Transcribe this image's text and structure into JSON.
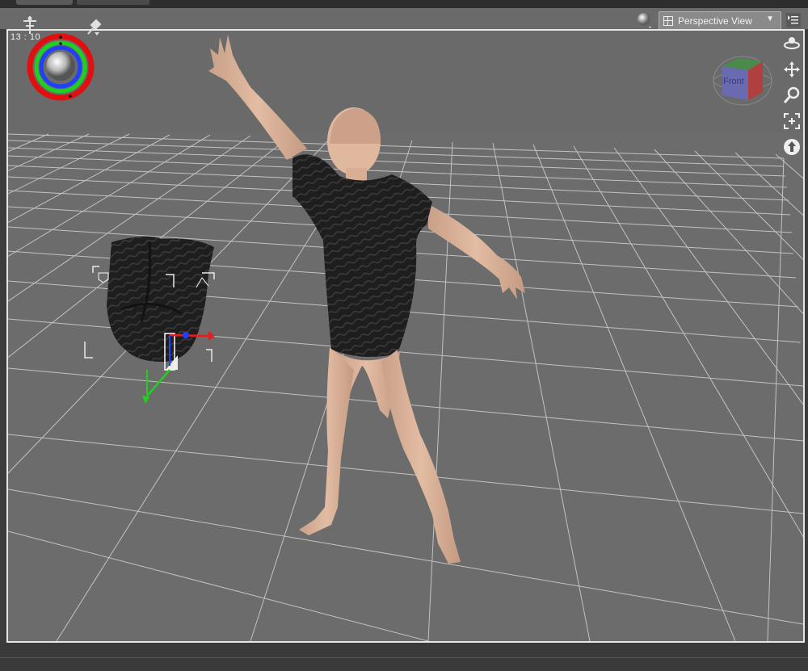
{
  "viewport": {
    "view_mode": "Perspective View",
    "time_readout": "13 : 10",
    "view_cube_face": "Front"
  },
  "icons": {
    "render_sphere": "sphere-shading-icon",
    "view_menu": "menu-list-icon",
    "orbit": "orbit-icon",
    "pan": "pan-icon",
    "zoom": "zoom-icon",
    "frame": "frame-icon",
    "reset": "reset-up-icon"
  },
  "colors": {
    "viewport_bg": "#6c6c6c",
    "grid_line": "#cfcfcf",
    "axis_x": "#e02020",
    "axis_y": "#20d020",
    "axis_z": "#2040ff"
  }
}
